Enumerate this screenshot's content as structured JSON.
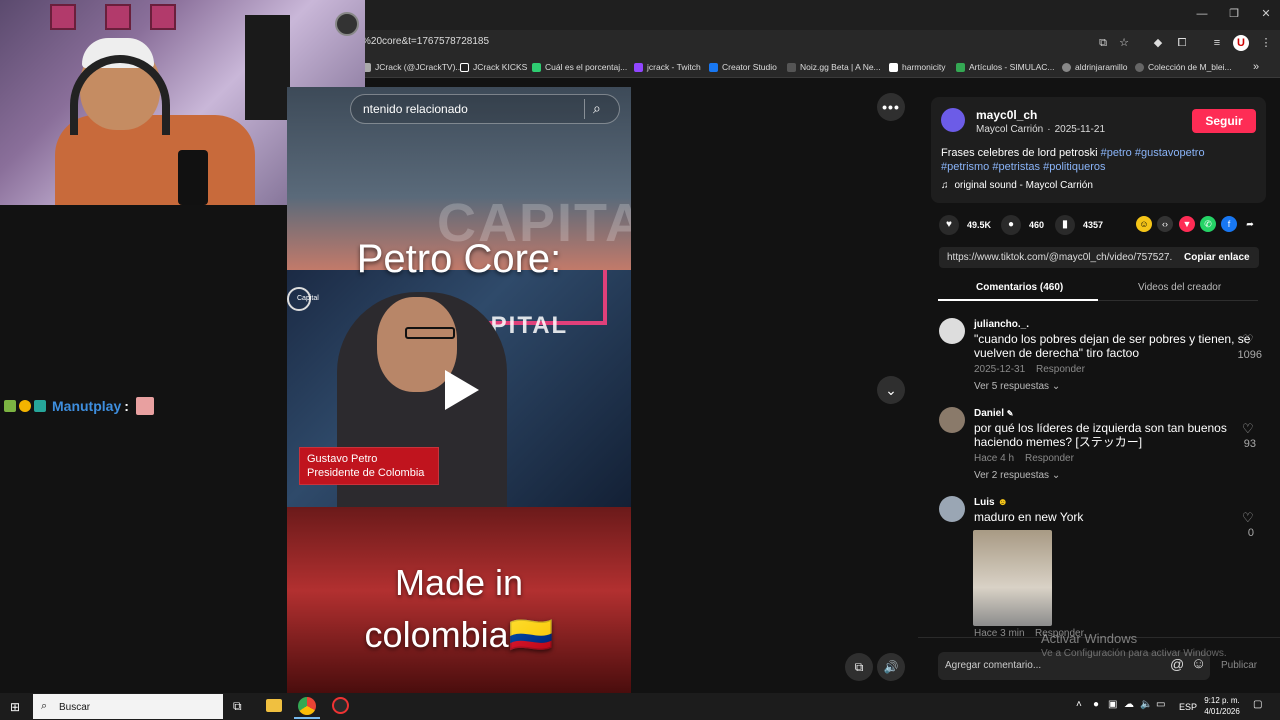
{
  "browser": {
    "url_fragment": "%20core&t=1767578728185",
    "bookmarks": [
      {
        "label": "JCrack (@JCrackTV)...",
        "color": "#aaaaaa"
      },
      {
        "label": "JCrack KICKS",
        "color": "#222222"
      },
      {
        "label": "Cuál es el porcentaj...",
        "color": "#2ecc71"
      },
      {
        "label": "jcrack - Twitch",
        "color": "#9146ff"
      },
      {
        "label": "Creator Studio",
        "color": "#1877f2"
      },
      {
        "label": "Noiz.gg Beta | A Ne...",
        "color": "#555555"
      },
      {
        "label": "harmonicity",
        "color": "#ffffff"
      },
      {
        "label": "Artículos - SIMULAC...",
        "color": "#34a853"
      },
      {
        "label": "aldrinjaramillo",
        "color": "#888888"
      },
      {
        "label": "Colección de M_blei...",
        "color": "#666666"
      }
    ]
  },
  "stream_chat": {
    "username": "Manutplay",
    "separator": ":"
  },
  "video": {
    "search_placeholder": "ntenido relacionado",
    "title_top": "Petro Core:",
    "watermark_brand": "CAPITAL",
    "brand_small": "CAPITAL",
    "logo_text": "Capital",
    "lower_third_name": "Gustavo Petro",
    "lower_third_role": "Presidente de Colombia",
    "title_bottom_line1": "Made in",
    "title_bottom_line2": "colombia🇨🇴"
  },
  "post": {
    "username": "mayc0l_ch",
    "display_name": "Maycol Carrión",
    "separator": "·",
    "date": "2025-11-21",
    "follow_label": "Seguir",
    "caption": "Frases celebres de lord petroski",
    "hashtags_line1": [
      "#petro",
      "#gustavopetro"
    ],
    "hashtags_line2": [
      "#petrismo",
      "#petristas",
      "#politiqueros"
    ],
    "sound": "original sound - Maycol Carrión",
    "likes": "49.5K",
    "comments": "460",
    "saves": "4357",
    "link": "https://www.tiktok.com/@mayc0l_ch/video/757527...",
    "copy_link_label": "Copiar enlace"
  },
  "tabs": {
    "comments": "Comentarios (460)",
    "creator_videos": "Videos del creador"
  },
  "comments": [
    {
      "user": "juliancho._.",
      "text_line1": "\"cuando los pobres dejan de ser pobres y tienen, se",
      "text_line2": "vuelven de derecha\" tiro factoo",
      "date": "2025-12-31",
      "reply": "Responder",
      "replies": "Ver 5 respuestas",
      "likes": "1096"
    },
    {
      "user": "Daniel",
      "text_line1": "por qué los líderes de izquierda son tan buenos",
      "text_line2": "haciendo memes? [ステッカー]",
      "date": "Hace 4 h",
      "reply": "Responder",
      "replies": "Ver 2 respuestas",
      "likes": "93"
    },
    {
      "user": "Luis",
      "text_line1": "maduro en new York",
      "text_line2": "",
      "date": "Hace 3 min",
      "reply": "Responder",
      "replies": "",
      "likes": "0"
    }
  ],
  "comment_input": {
    "placeholder": "Agregar comentario...",
    "post_label": "Publicar"
  },
  "windows_watermark": {
    "line1": "Activar Windows",
    "line2": "Ve a Configuración para activar Windows."
  },
  "taskbar": {
    "search_label": "Buscar",
    "lang": "ESP",
    "time": "9:12 p. m.",
    "date": "4/01/2026"
  }
}
